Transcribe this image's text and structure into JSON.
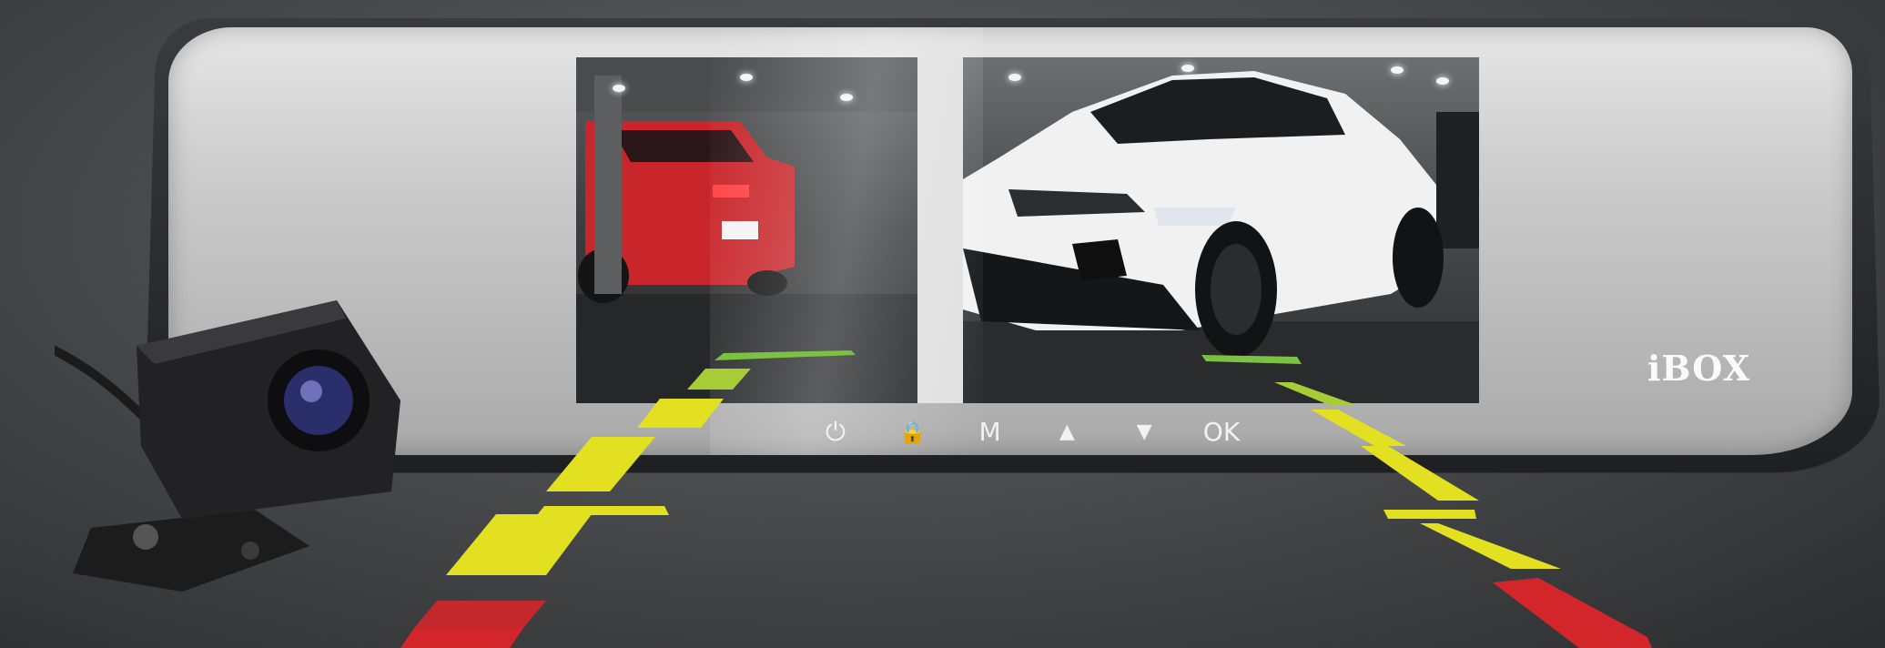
{
  "brand": {
    "logo_text": "iBOX"
  },
  "mirror": {
    "controls": [
      {
        "name": "power-button",
        "icon": "power-icon",
        "label": "⏻"
      },
      {
        "name": "lock-button",
        "icon": "lock-icon",
        "label": "🔒"
      },
      {
        "name": "menu-button",
        "icon": "",
        "label": "M"
      },
      {
        "name": "up-button",
        "icon": "triangle-up-icon",
        "label": "▲"
      },
      {
        "name": "down-button",
        "icon": "triangle-down-icon",
        "label": "▼"
      },
      {
        "name": "ok-button",
        "icon": "",
        "label": "OK"
      }
    ]
  },
  "screen": {
    "left_view_car_color": "#c8262b",
    "right_view_car_color": "#f2f2f2"
  },
  "parking_guides": {
    "colors": {
      "green": "#7cc242",
      "yellow": "#e3e022",
      "red": "#d3262a"
    }
  }
}
